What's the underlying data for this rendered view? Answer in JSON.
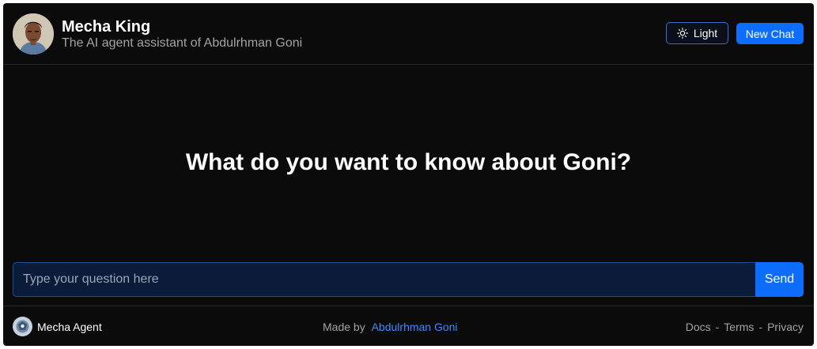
{
  "header": {
    "title": "Mecha King",
    "subtitle": "The AI agent assistant of Abdulrhman Goni",
    "theme_button_label": "Light",
    "theme_icon": "sun-icon",
    "new_chat_label": "New Chat"
  },
  "main": {
    "heading": "What do you want to know about Goni?"
  },
  "composer": {
    "placeholder": "Type your question here",
    "value": "",
    "send_label": "Send"
  },
  "footer": {
    "brand": "Mecha Agent",
    "made_by_prefix": "Made by",
    "author": "Abdulrhman Goni",
    "links": [
      "Docs",
      "Terms",
      "Privacy"
    ],
    "separator": "-"
  },
  "colors": {
    "background": "#0b0b0b",
    "accent": "#0d6efd",
    "link": "#3d8bfd",
    "input_bg": "#0a1c3a",
    "muted_text": "#a3a3a3"
  }
}
